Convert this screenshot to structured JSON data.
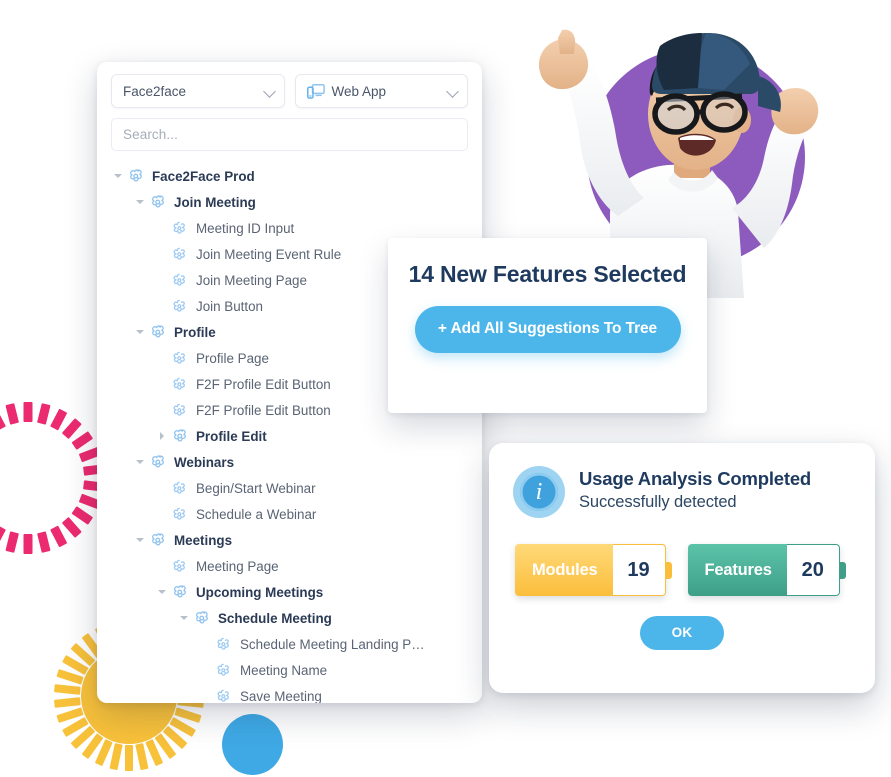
{
  "tree_panel": {
    "app_select": {
      "value": "Face2face",
      "icon": "chevron-down-icon"
    },
    "platform_select": {
      "value": "Web App",
      "icon": "web-app-device-icon"
    },
    "search": {
      "placeholder": "Search..."
    },
    "nodes": [
      {
        "label": "Face2Face Prod",
        "depth": 0,
        "type": "folder",
        "arrow": "open",
        "icon": "module-icon"
      },
      {
        "label": "Join Meeting",
        "depth": 1,
        "type": "folder",
        "arrow": "open",
        "icon": "module-icon"
      },
      {
        "label": "Meeting ID Input",
        "depth": 2,
        "type": "feature",
        "arrow": "none",
        "icon": "feature-icon"
      },
      {
        "label": "Join Meeting Event Rule",
        "depth": 2,
        "type": "feature",
        "arrow": "none",
        "icon": "feature-icon"
      },
      {
        "label": "Join Meeting Page",
        "depth": 2,
        "type": "feature",
        "arrow": "none",
        "icon": "feature-icon"
      },
      {
        "label": "Join Button",
        "depth": 2,
        "type": "feature",
        "arrow": "none",
        "icon": "feature-icon"
      },
      {
        "label": "Profile",
        "depth": 1,
        "type": "folder",
        "arrow": "open",
        "icon": "module-icon"
      },
      {
        "label": "Profile Page",
        "depth": 2,
        "type": "feature",
        "arrow": "none",
        "icon": "feature-icon"
      },
      {
        "label": "F2F Profile Edit Button",
        "depth": 2,
        "type": "feature",
        "arrow": "none",
        "icon": "feature-icon"
      },
      {
        "label": "F2F Profile Edit Button",
        "depth": 2,
        "type": "feature",
        "arrow": "none",
        "icon": "feature-icon"
      },
      {
        "label": "Profile Edit",
        "depth": 2,
        "type": "folder",
        "arrow": "closed",
        "icon": "module-icon"
      },
      {
        "label": "Webinars",
        "depth": 1,
        "type": "folder",
        "arrow": "open",
        "icon": "module-icon"
      },
      {
        "label": "Begin/Start Webinar",
        "depth": 2,
        "type": "feature",
        "arrow": "none",
        "icon": "feature-icon"
      },
      {
        "label": "Schedule a Webinar",
        "depth": 2,
        "type": "feature",
        "arrow": "none",
        "icon": "feature-icon"
      },
      {
        "label": "Meetings",
        "depth": 1,
        "type": "folder",
        "arrow": "open",
        "icon": "module-icon"
      },
      {
        "label": "Meeting Page",
        "depth": 2,
        "type": "feature",
        "arrow": "none",
        "icon": "feature-icon"
      },
      {
        "label": "Upcoming Meetings",
        "depth": 2,
        "type": "folder",
        "arrow": "open",
        "icon": "module-icon"
      },
      {
        "label": "Schedule Meeting",
        "depth": 3,
        "type": "folder",
        "arrow": "open",
        "icon": "module-icon"
      },
      {
        "label": "Schedule Meeting Landing P…",
        "depth": 4,
        "type": "feature",
        "arrow": "none",
        "icon": "feature-icon"
      },
      {
        "label": "Meeting Name",
        "depth": 4,
        "type": "feature",
        "arrow": "none",
        "icon": "feature-icon"
      },
      {
        "label": "Save Meeting",
        "depth": 4,
        "type": "feature",
        "arrow": "none",
        "icon": "feature-icon"
      }
    ]
  },
  "suggest_card": {
    "headline": "14 New Features Selected",
    "add_button": "+ Add All Suggestions To Tree"
  },
  "usage_card": {
    "icon": "info-circle-icon",
    "title": "Usage Analysis Completed",
    "subtitle": "Successfully  detected",
    "stats": [
      {
        "name": "Modules",
        "value": "19"
      },
      {
        "name": "Features",
        "value": "20"
      }
    ],
    "ok_button": "OK"
  },
  "decor": {
    "pink_ring": "pink-dashed-ring",
    "sun_burst": "yellow-sunburst",
    "blue_dot": "blue-circle",
    "purple_circle": "purple-circle",
    "hero": "celebrating-person-photo"
  },
  "colors": {
    "accent_blue": "#4cb6ea",
    "navy": "#1f3a5f",
    "modules_yellow": "#fbbe3c",
    "features_green": "#3e9f89",
    "pink": "#ec2a70",
    "sun_yellow": "#f8c13a",
    "purple": "#8c5bbd"
  }
}
